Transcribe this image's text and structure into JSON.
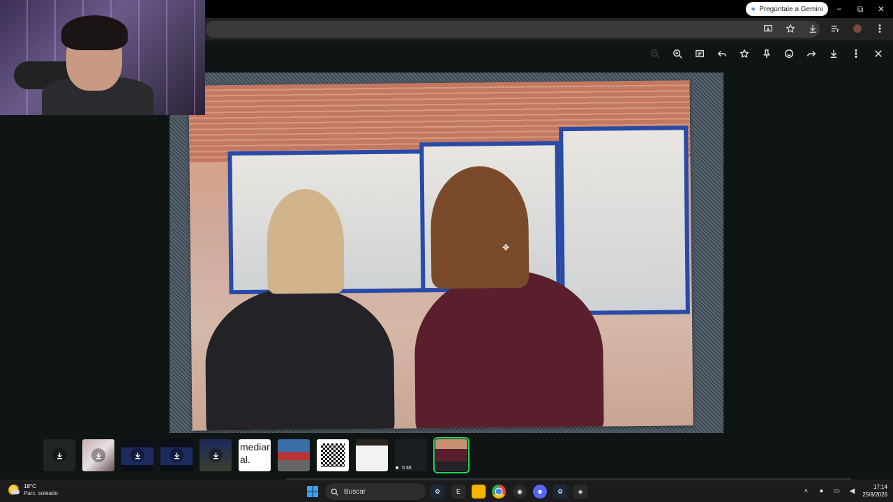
{
  "browser": {
    "gemini_label": "Pregúntale a Gemini",
    "window_controls": {
      "minimize": "−",
      "maximize": "⧉",
      "close": "✕"
    }
  },
  "viewer": {
    "toolbar_icons": [
      "zoom-out-icon",
      "zoom-in-icon",
      "caption-icon",
      "reply-icon",
      "star-icon",
      "pin-icon",
      "emoji-icon",
      "forward-icon",
      "download-icon",
      "more-icon",
      "close-icon"
    ]
  },
  "filmstrip": {
    "thumbs": [
      {
        "kind": "download"
      },
      {
        "kind": "download"
      },
      {
        "kind": "download"
      },
      {
        "kind": "download"
      },
      {
        "kind": "download"
      },
      {
        "kind": "text",
        "text": "mediar al."
      },
      {
        "kind": "image"
      },
      {
        "kind": "qr"
      },
      {
        "kind": "document"
      },
      {
        "kind": "video",
        "duration": "0:36"
      },
      {
        "kind": "image",
        "selected": true
      }
    ]
  },
  "taskbar": {
    "weather_temp": "18°C",
    "weather_desc": "Parc. soleado",
    "search_label": "Buscar",
    "time": "17:14",
    "date": "25/8/2026"
  }
}
